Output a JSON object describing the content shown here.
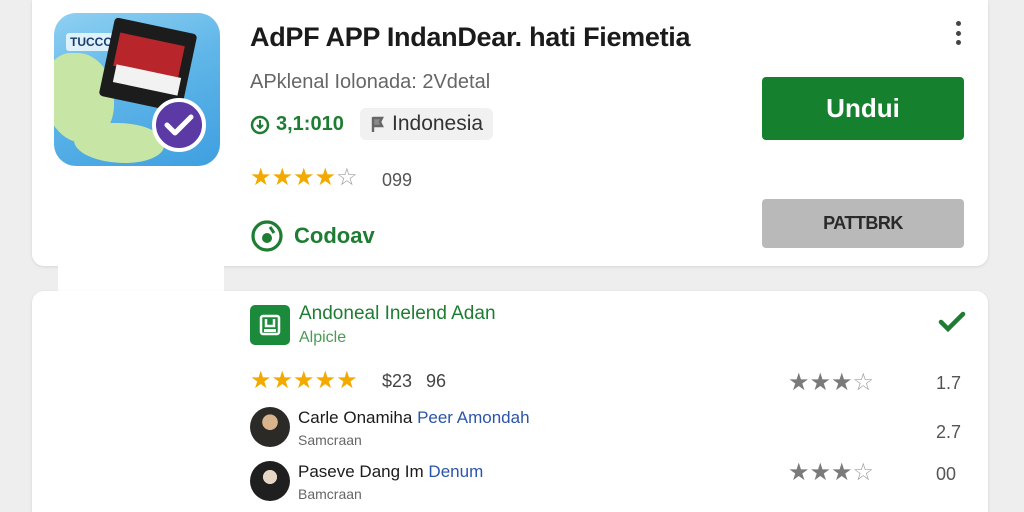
{
  "app": {
    "title": "AdPF APP IndanDear. hati Fiemetia",
    "subtitle": "APklenal Iolonada: 2Vdetal",
    "downloads": "3,1:010",
    "country": "Indonesia",
    "rating_stars": 4,
    "rating_count": "099",
    "compat_label": "Codoav",
    "install_label": "Undui",
    "secondary_label": "PATTBRK",
    "icon_chip_text": "TUCCO"
  },
  "developer": {
    "name": "Andoneal Inelend Adan",
    "sub": "Alpicle"
  },
  "ratings": {
    "summary_stars": 5,
    "value_a": "$23",
    "value_b": "96",
    "right_stars": 3,
    "right_value": "1.7"
  },
  "reviews": [
    {
      "name": "Carle Onamiha",
      "highlight": "Peer Amondah",
      "sub": "Samcraan",
      "score": "2.7"
    },
    {
      "name": "Paseve Dang Im",
      "highlight": "Denum",
      "sub": "Bamcraan",
      "stars": 3,
      "score": "00"
    }
  ],
  "colors": {
    "accent_green": "#15812e",
    "star_gold": "#f2a900",
    "badge_purple": "#5b3aa6",
    "secondary_gray": "#b9b9b9"
  },
  "icons": {
    "menu": "more-vertical-icon",
    "downloads": "download-circle-icon",
    "country": "flag-icon",
    "compat": "check-circle-icon",
    "developer": "developer-badge-icon",
    "verified": "verified-check-icon"
  }
}
